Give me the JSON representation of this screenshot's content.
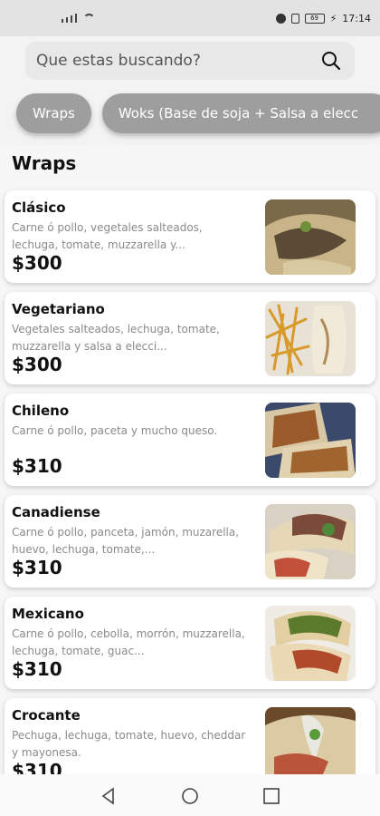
{
  "status": {
    "time": "17:14",
    "battery": "69"
  },
  "search": {
    "placeholder": "Que estas buscando?"
  },
  "categories": [
    {
      "label": "Wraps"
    },
    {
      "label": "Woks (Base de soja + Salsa a elecc"
    }
  ],
  "section": {
    "title": "Wraps"
  },
  "products": [
    {
      "name": "Clásico",
      "description": "Carne ó pollo, vegetales salteados, lechuga, tomate, muzzarella y...",
      "price": "$300",
      "image": "wrap-photo"
    },
    {
      "name": "Vegetariano",
      "description": "Vegetales salteados, lechuga, tomate, muzzarella y salsa a elecci...",
      "price": "$300",
      "image": "fries-and-wrap-photo"
    },
    {
      "name": "Chileno",
      "description": "Carne ó pollo, paceta y mucho queso.",
      "price": "$310",
      "image": "wrap-photo"
    },
    {
      "name": "Canadiense",
      "description": "Carne ó pollo, panceta, jamón, muzarella, huevo, lechuga, tomate,...",
      "price": "$310",
      "image": "wrap-photo"
    },
    {
      "name": "Mexicano",
      "description": "Carne ó pollo, cebolla, morrón, muzzarella, lechuga, tomate, guac...",
      "price": "$310",
      "image": "wrap-photo"
    },
    {
      "name": "Crocante",
      "description": "Pechuga, lechuga, tomate, huevo, cheddar y mayonesa.",
      "price": "$310",
      "image": "wrap-photo"
    }
  ],
  "colors": {
    "chip": "#9e9e9e",
    "accent_text": "#111111",
    "muted_text": "#8a8a8a"
  }
}
